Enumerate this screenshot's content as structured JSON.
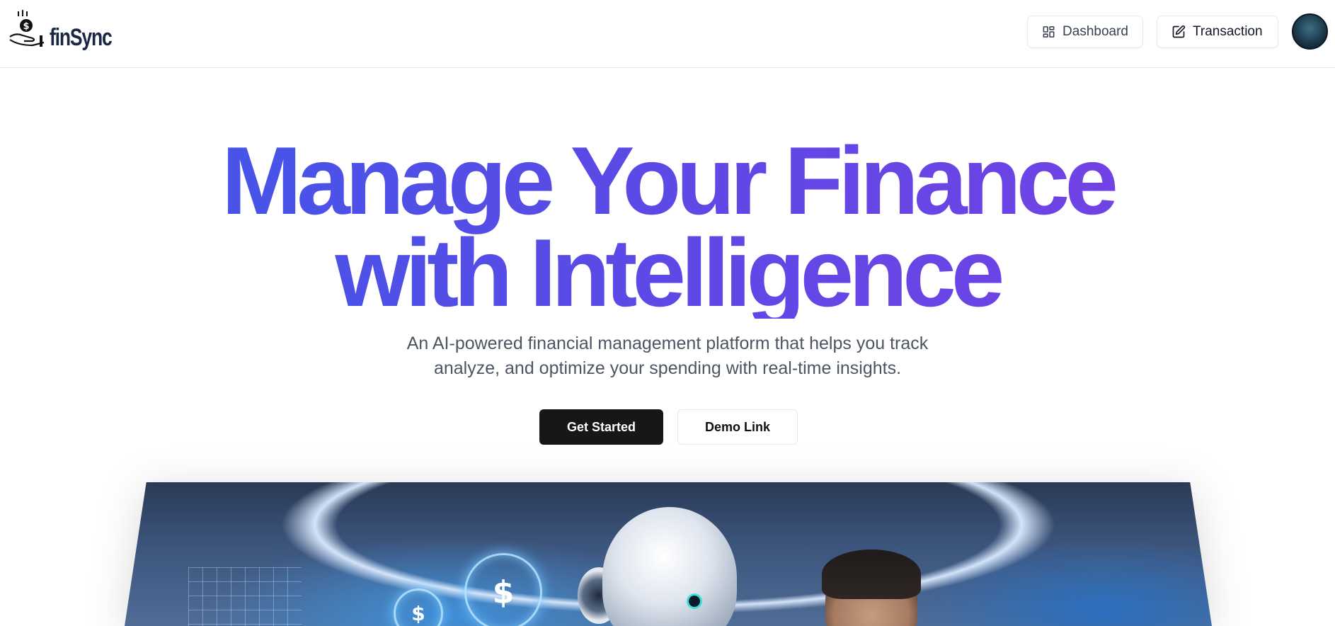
{
  "brand": {
    "name": "finSync",
    "coin_symbol": "$"
  },
  "nav": {
    "dashboard_label": "Dashboard",
    "transaction_label": "Transaction"
  },
  "hero": {
    "title_line1": "Manage Your Finance",
    "title_line2": "with Intelligence",
    "subtitle_line1": "An AI-powered financial management platform that helps you track",
    "subtitle_line2": "analyze, and optimize your spending with real-time insights.",
    "primary_cta": "Get Started",
    "secondary_cta": "Demo Link"
  },
  "hero_image": {
    "coin_symbol": "$"
  },
  "colors": {
    "title_gradient_start": "#3b5be8",
    "title_gradient_end": "#7b3fe4",
    "primary_button": "#171717",
    "logo_text": "#1a2744"
  },
  "icons": {
    "dashboard": "layout-grid-icon",
    "transaction": "pen-square-icon",
    "logo": "hand-coin-icon"
  }
}
